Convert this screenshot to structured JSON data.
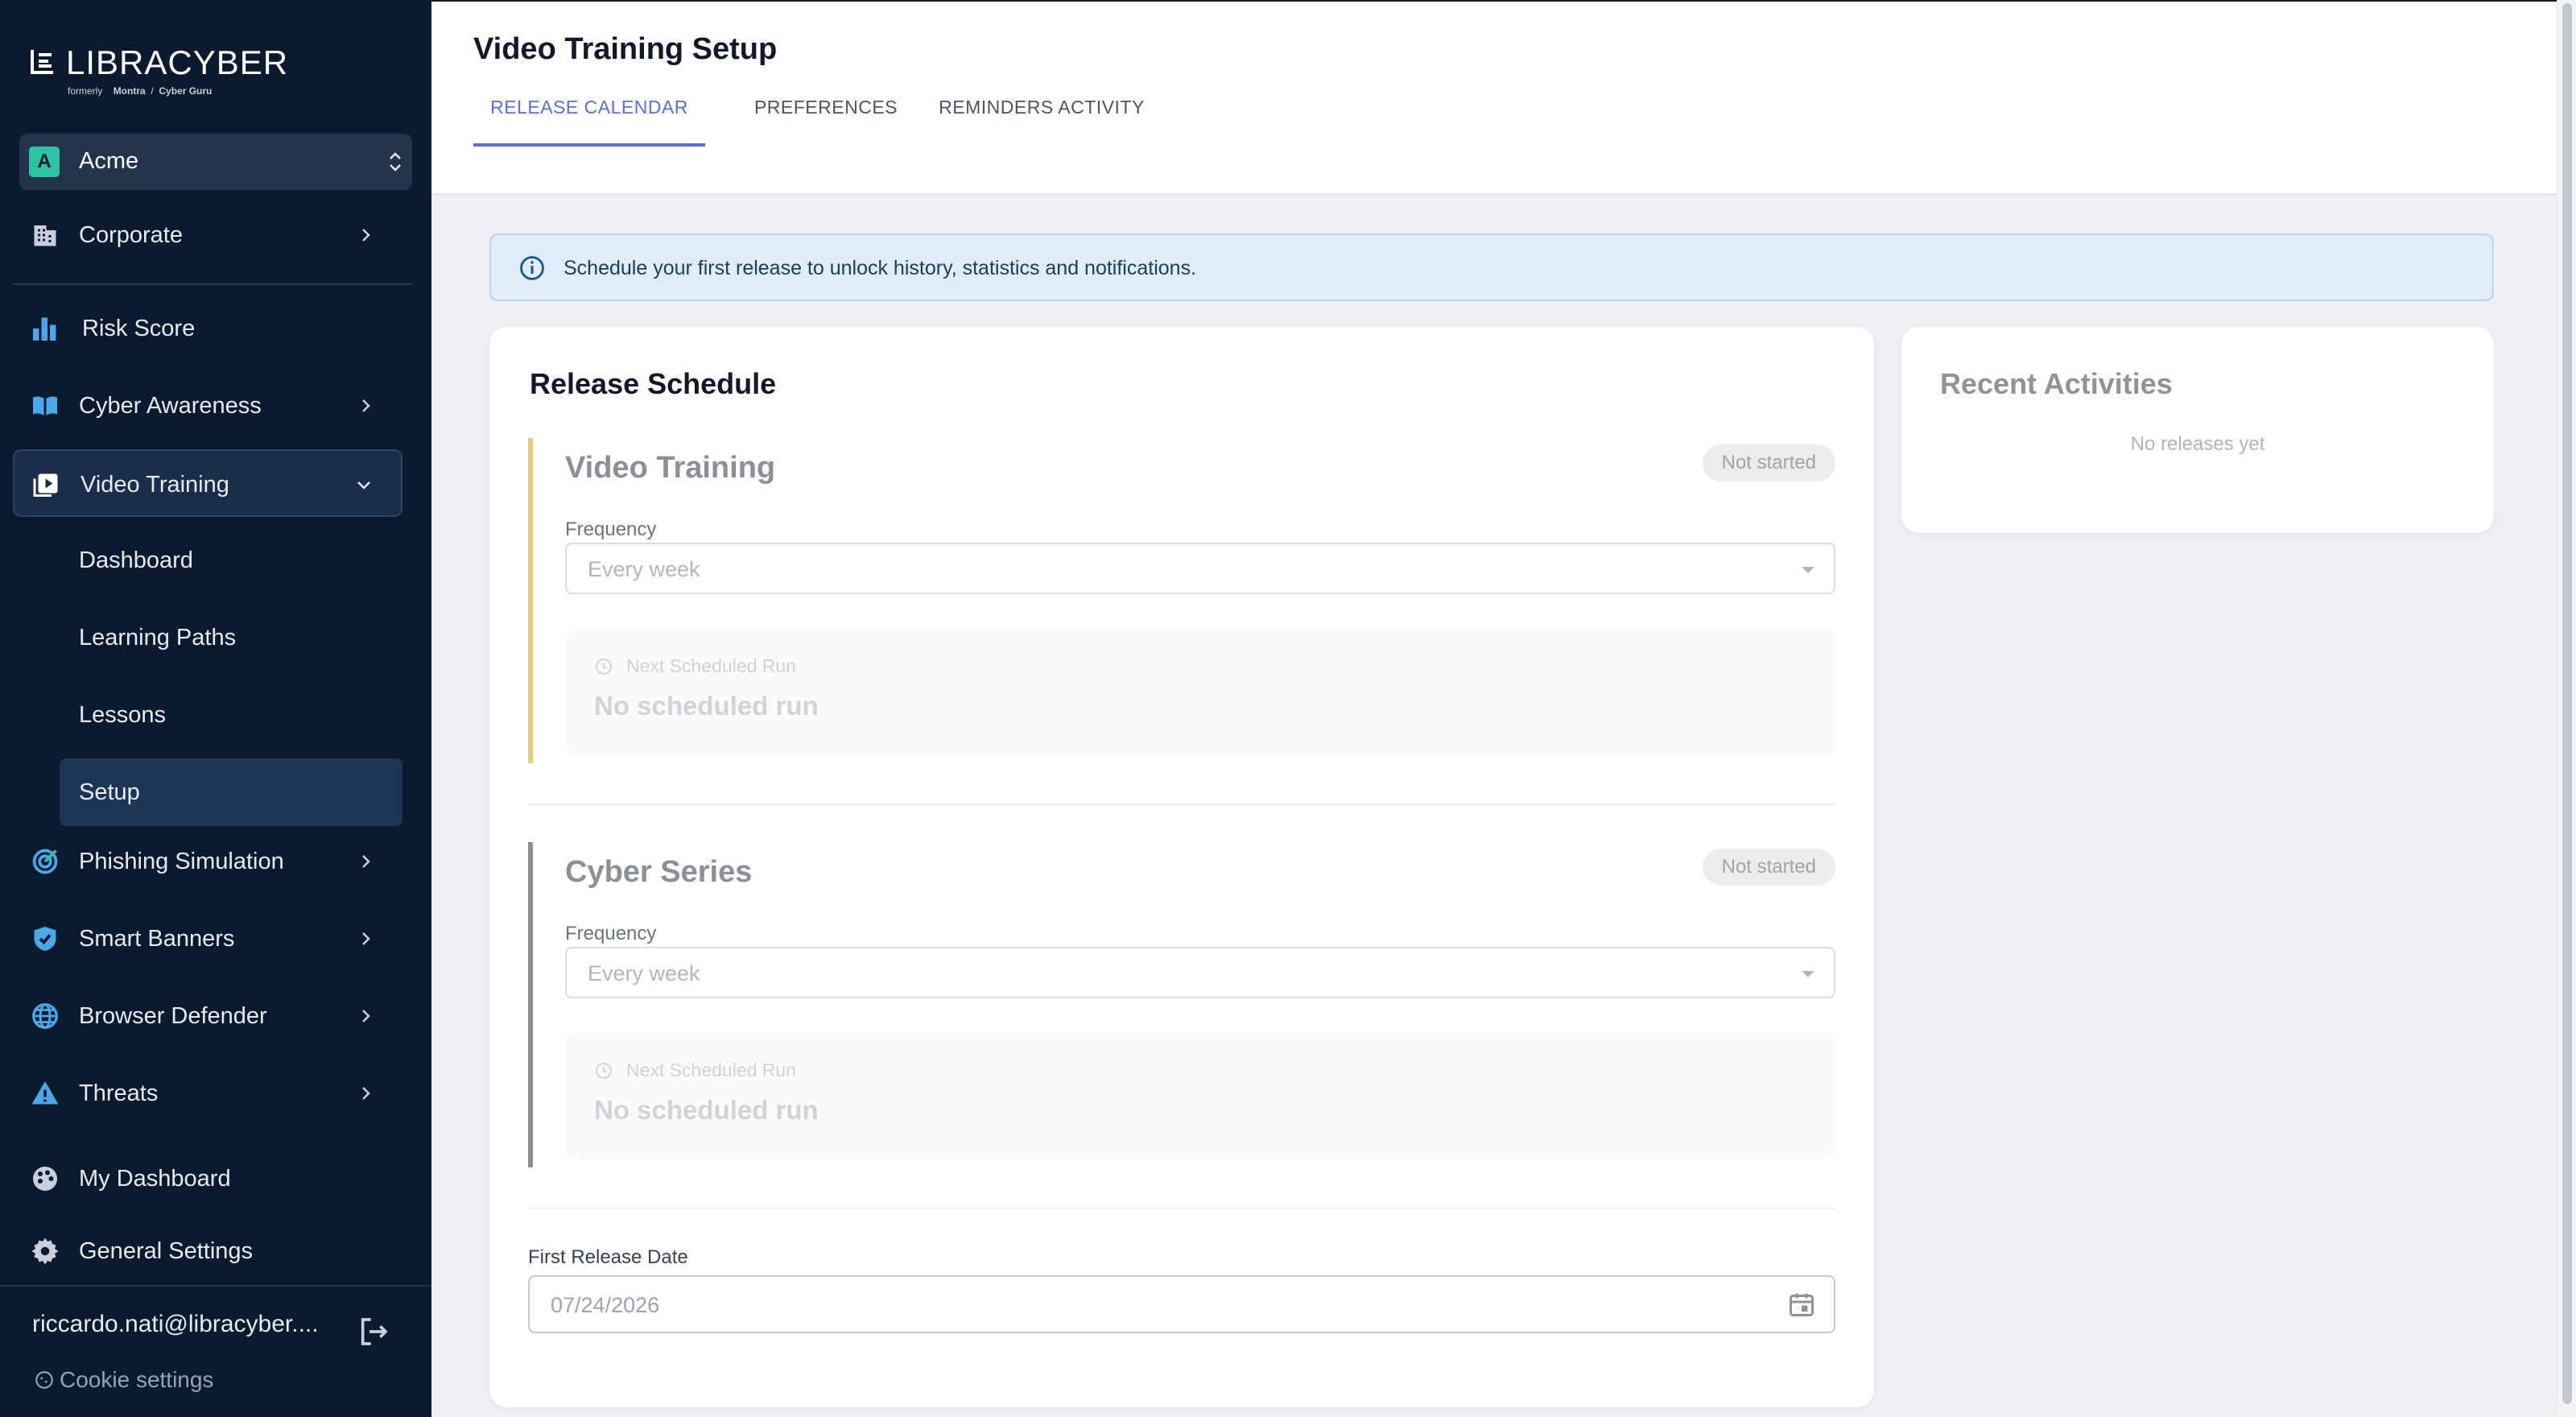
{
  "brand": {
    "name": "LIBRACYBER",
    "formerly": "formerly",
    "former_brand_1": "Montra",
    "separator": "/",
    "former_brand_2": "Cyber Guru"
  },
  "org": {
    "avatar": "A",
    "name": "Acme"
  },
  "nav": {
    "corporate": "Corporate",
    "risk_score": "Risk Score",
    "cyber_awareness": "Cyber Awareness",
    "video_training": "Video Training",
    "video_sub": {
      "dashboard": "Dashboard",
      "learning_paths": "Learning Paths",
      "lessons": "Lessons",
      "setup": "Setup"
    },
    "phishing_simulation": "Phishing Simulation",
    "smart_banners": "Smart Banners",
    "browser_defender": "Browser Defender",
    "threats": "Threats",
    "my_dashboard": "My Dashboard",
    "general_settings": "General Settings"
  },
  "user": {
    "email": "riccardo.nati@libracyber....",
    "cookie_settings": "Cookie settings"
  },
  "page": {
    "title": "Video Training Setup",
    "tabs": [
      "RELEASE CALENDAR",
      "PREFERENCES",
      "REMINDERS ACTIVITY"
    ],
    "info": "Schedule your first release to unlock history, statistics and notifications."
  },
  "release": {
    "title": "Release Schedule",
    "blocks": [
      {
        "name": "Video Training",
        "status": "Not started",
        "frequency_label": "Frequency",
        "frequency": "Every week",
        "next_run_label": "Next Scheduled Run",
        "next_run": "No scheduled run",
        "accent": "#e6cf7a"
      },
      {
        "name": "Cyber Series",
        "status": "Not started",
        "frequency_label": "Frequency",
        "frequency": "Every week",
        "next_run_label": "Next Scheduled Run",
        "next_run": "No scheduled run",
        "accent": "#8b8f96"
      }
    ],
    "first_date_label": "First Release Date",
    "first_date_placeholder": "07/24/2026"
  },
  "activities": {
    "title": "Recent Activities",
    "empty": "No releases yet"
  },
  "colors": {
    "sidebar_bg": "#0b1a2c",
    "accent": "#5b6fd6",
    "org_avatar": "#2bc3a4",
    "info_bg": "#dfeef6"
  }
}
